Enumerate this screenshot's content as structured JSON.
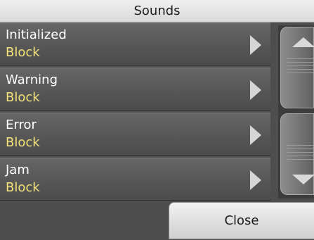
{
  "header": {
    "title": "Sounds"
  },
  "items": [
    {
      "label": "Initialized",
      "value": "Block"
    },
    {
      "label": "Warning",
      "value": "Block"
    },
    {
      "label": "Error",
      "value": "Block"
    },
    {
      "label": "Jam",
      "value": "Block"
    }
  ],
  "icons": {
    "item_arrow": "chevron-right-icon",
    "scroll_up": "arrow-up-icon",
    "scroll_down": "arrow-down-icon"
  },
  "colors": {
    "label": "#ffffff",
    "value": "#f4e27a",
    "background": "#4e4e4e"
  },
  "footer": {
    "close_label": "Close"
  }
}
